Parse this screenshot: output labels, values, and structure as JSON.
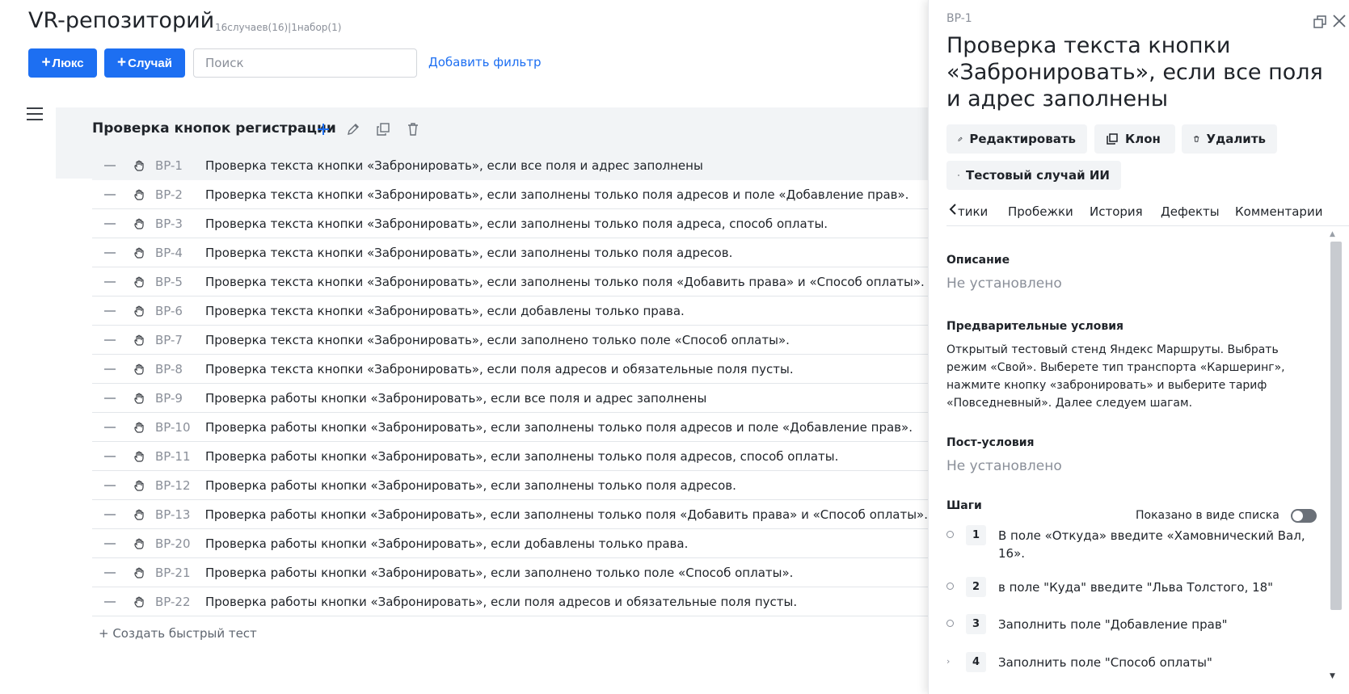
{
  "repo": {
    "title": "VR-репозиторий",
    "meta": "16случаев(16)|1набор(1)"
  },
  "toolbar": {
    "suite_button": "Люкс",
    "case_button": "Случай",
    "search_placeholder": "Поиск",
    "add_filter": "Добавить фильтр"
  },
  "suite": {
    "title": "Проверка кнопок регистрации"
  },
  "cases": [
    {
      "id": "BP-1",
      "title": "Проверка текста кнопки «Забронировать», если все поля и адрес заполнены"
    },
    {
      "id": "BP-2",
      "title": "Проверка текста кнопки «Забронировать», если заполнены только поля адресов и поле «Добавление прав»."
    },
    {
      "id": "BP-3",
      "title": "Проверка текста кнопки «Забронировать», если заполнены только поля адреса, способ оплаты."
    },
    {
      "id": "BP-4",
      "title": "Проверка текста кнопки «Забронировать», если заполнены только поля адресов."
    },
    {
      "id": "BP-5",
      "title": "Проверка текста кнопки «Забронировать», если заполнены только поля «Добавить права» и «Способ оплаты»."
    },
    {
      "id": "BP-6",
      "title": "Проверка текста кнопки «Забронировать», если добавлены только права."
    },
    {
      "id": "BP-7",
      "title": "Проверка текста кнопки «Забронировать», если заполнено только поле «Способ оплаты»."
    },
    {
      "id": "BP-8",
      "title": "Проверка текста кнопки «Забронировать», если поля адресов и обязательные поля пусты."
    },
    {
      "id": "BP-9",
      "title": "Проверка работы кнопки «Забронировать», если все поля и адрес заполнены"
    },
    {
      "id": "BP-10",
      "title": "Проверка работы кнопки «Забронировать», если заполнены только поля адресов и поле «Добавление прав»."
    },
    {
      "id": "BP-11",
      "title": "Проверка работы кнопки «Забронировать», если заполнены только поля адресов, способ оплаты."
    },
    {
      "id": "BP-12",
      "title": "Проверка работы кнопки «Забронировать», если заполнены только поля адресов."
    },
    {
      "id": "BP-13",
      "title": "Проверка работы кнопки «Забронировать», если заполнены только поля «Добавить права» и «Способ оплаты»."
    },
    {
      "id": "BP-20",
      "title": "Проверка работы кнопки «Забронировать», если добавлены только права."
    },
    {
      "id": "BP-21",
      "title": "Проверка работы кнопки «Забронировать», если заполнено только поле «Способ оплаты»."
    },
    {
      "id": "BP-22",
      "title": "Проверка работы кнопки «Забронировать», если поля адресов и обязательные поля пусты."
    }
  ],
  "quick_test": "+ Создать быстрый тест",
  "panel": {
    "case_id": "BP-1",
    "title": "Проверка текста кнопки «Забронировать», если все поля и адрес заполнены",
    "actions": {
      "edit": "Редактировать",
      "clone": "Клон",
      "delete": "Удалить",
      "ai_case": "Тестовый случай ИИ"
    },
    "tabs": [
      "тики",
      "Пробежки",
      "История",
      "Дефекты",
      "Комментарии"
    ],
    "description_label": "Описание",
    "description_value": "Не установлено",
    "preconditions_label": "Предварительные условия",
    "preconditions_text": "Открытый тестовый стенд Яндекс Маршруты. Выбрать режим «Свой». Выберете тип транспорта «Каршеринг», нажмите кнопку «забронировать» и выберите тариф «Повседневный». Далее следуем шагам.",
    "postconditions_label": "Пост-условия",
    "postconditions_value": "Не установлено",
    "steps_label": "Шаги",
    "list_view_label": "Показано в виде списка",
    "steps": [
      {
        "num": "1",
        "text": "В поле «Откуда» введите «Хамовнический Вал, 16»."
      },
      {
        "num": "2",
        "text": "в поле \"Куда\" введите \"Льва Толстого, 18\""
      },
      {
        "num": "3",
        "text": "Заполнить поле \"Добавление прав\""
      },
      {
        "num": "4",
        "text": "Заполнить поле \"Способ оплаты\""
      }
    ]
  },
  "colors": {
    "accent": "#1d6ff2",
    "row_selected": "#f2f4f6"
  }
}
